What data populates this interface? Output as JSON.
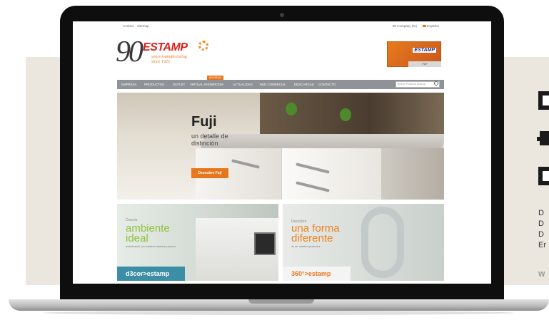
{
  "flyer": {
    "lines": [
      "D",
      "D",
      "D",
      "Er"
    ],
    "web": "W"
  },
  "site": {
    "topbar": {
      "contact": "Contact",
      "sitemap": "Sitemap",
      "company": "90 Company (EI)",
      "language": "Español"
    },
    "logo": {
      "number": "90",
      "brand": "ESTAMP",
      "tagline": "years manufacturing since 1925"
    },
    "catalog": {
      "brand": "ESTAMP",
      "button": "PDF"
    },
    "nav": {
      "items": [
        "EMPRESA",
        "PRODUCTOS",
        "OUTLET",
        "VIRTUAL SHOWROOM",
        "ACTUALIDAD",
        "RED COMERCIAL",
        "DESCARGAS",
        "CONTACTO"
      ],
      "badge": "NOVEDAD",
      "search_placeholder": "Buscar Producto Estamp"
    },
    "hero": {
      "title": "Fuji",
      "subtitle": "un detalle de distinción",
      "button": "Descubre Fuji"
    },
    "promos": [
      {
        "small": "Crea tu",
        "big_line1": "ambiente",
        "big_line2": "ideal",
        "tiny": "relacionando con nuestros tiradores y pomos",
        "brand": "d3cor>estamp"
      },
      {
        "small": "Descubre",
        "big_line1": "una forma",
        "big_line2": "diferente",
        "tiny": "de ver nuestros productos",
        "brand": "360°>estamp"
      }
    ]
  },
  "colors": {
    "accent": "#e8761d",
    "brand_red": "#d9231d",
    "nav_bg": "#8f9296",
    "green": "#8cc23b"
  }
}
